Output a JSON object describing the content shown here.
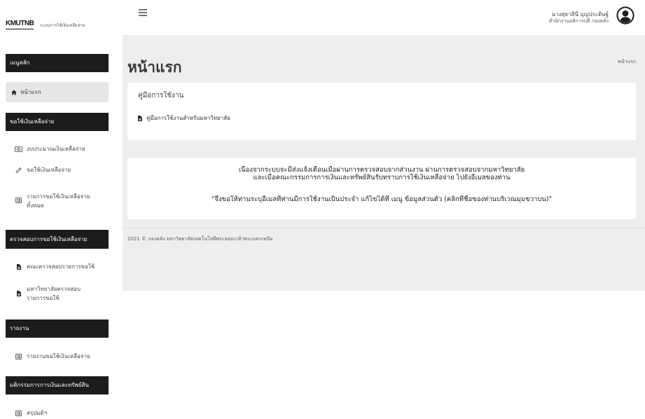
{
  "app": {
    "logo": "KMUTNB",
    "subtitle": "ระบบการใช้เงินเหลือจ่าย"
  },
  "header": {
    "menu_icon": "hamburger-icon",
    "user_name": "นางสุธาสินี บุญประดิษฐ์",
    "user_unit": "สำนักงานอธิการบดี กองคลัง",
    "avatar_icon": "user-circle-icon"
  },
  "sidebar": {
    "sections": [
      {
        "title": "เมนูหลัก",
        "items": [
          {
            "label": "หน้าแรก",
            "icon": "home-icon",
            "active": true
          }
        ]
      },
      {
        "title": "ขอใช้เงินเหลือจ่าย",
        "items": [
          {
            "label": "งบประมาณเงินเหลือจ่าย",
            "icon": "money-bill-icon"
          },
          {
            "label": "ขอใช้เงินเหลือจ่าย",
            "icon": "pencil-icon"
          },
          {
            "label": "รายการขอใช้เงินเหลือจ่าย ทั้งหมด",
            "icon": "list-alt-icon"
          }
        ]
      },
      {
        "title": "ตรวจสอบการขอใช้เงินเหลือจ่าย",
        "items": [
          {
            "label": "คณะตรวจสอบรายการขอใช้",
            "icon": "file-icon"
          },
          {
            "label": "มหาวิทยาลัยตรวจสอบ รายการขอใช้",
            "icon": "file-icon"
          }
        ]
      },
      {
        "title": "รายงาน",
        "items": [
          {
            "label": "รายงานขอใช้เงินเหลือจ่าย",
            "icon": "list-alt-icon"
          }
        ]
      },
      {
        "title": "มติกรรมการการเงินและทรัพย์สิน",
        "items": [
          {
            "label": "สรุปมติฯ",
            "icon": "list-alt-icon"
          }
        ]
      }
    ]
  },
  "main": {
    "title": "หน้าแรก",
    "breadcrumb": "หน้าแรก",
    "manual": {
      "title": "คู่มือการใช้งาน",
      "link_icon": "file-icon",
      "link_label": "คู่มือการใช้งานสำหรับมหาวิทยาลัย"
    },
    "notice": {
      "line1": "เนื่องจากระบบจะมีส่งแจ้งเตือนเมื่อผ่านการตรวจสอบจากส่วนงาน ผ่านการตรวจสอบจากมหาวิทยาลัย",
      "line2": "และเมื่อคณะกรรมการการเงินและทรัพย์สินรับทราบการใช้เงินเหลือจ่าย ไปยังอีเมลของท่าน",
      "line3": "\"จึงขอให้ท่านระบุอีเมลที่ท่านมีการใช้งานเป็นประจำ แก้ไขได้ที่ เมนู ข้อมูลส่วนตัว (คลิกที่ชื่อของท่านบริเวณมุมขวาบน)\""
    }
  },
  "footer": {
    "text": "2021 © กองคลัง มหาวิทยาลัยเทคโนโลยีพระจอมเกล้าพระนครเหนือ"
  },
  "colors": {
    "sidebar_header_bg": "#1c1c1c",
    "content_bg": "#eeeeee",
    "card_bg": "#ffffff",
    "active_item_bg": "#e7e7e7"
  }
}
